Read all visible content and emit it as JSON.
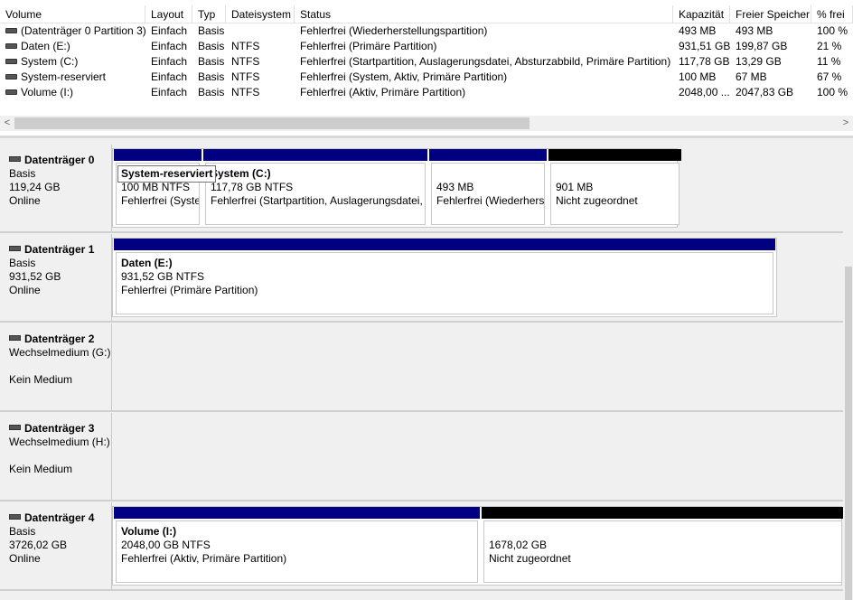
{
  "columns": [
    "Volume",
    "Layout",
    "Typ",
    "Dateisystem",
    "Status",
    "Kapazität",
    "Freier Speicher",
    "% frei"
  ],
  "volumes": [
    {
      "name": "(Datenträger 0 Partition 3)",
      "layout": "Einfach",
      "type": "Basis",
      "fs": "",
      "status": "Fehlerfrei (Wiederherstellungspartition)",
      "capacity": "493 MB",
      "free": "493 MB",
      "pct": "100 %"
    },
    {
      "name": "Daten (E:)",
      "layout": "Einfach",
      "type": "Basis",
      "fs": "NTFS",
      "status": "Fehlerfrei (Primäre Partition)",
      "capacity": "931,51 GB",
      "free": "199,87 GB",
      "pct": "21 %"
    },
    {
      "name": "System (C:)",
      "layout": "Einfach",
      "type": "Basis",
      "fs": "NTFS",
      "status": "Fehlerfrei (Startpartition, Auslagerungsdatei, Absturzabbild, Primäre Partition)",
      "capacity": "117,78 GB",
      "free": "13,29 GB",
      "pct": "11 %"
    },
    {
      "name": "System-reserviert",
      "layout": "Einfach",
      "type": "Basis",
      "fs": "NTFS",
      "status": "Fehlerfrei (System, Aktiv, Primäre Partition)",
      "capacity": "100 MB",
      "free": "67 MB",
      "pct": "67 %"
    },
    {
      "name": "Volume (I:)",
      "layout": "Einfach",
      "type": "Basis",
      "fs": "NTFS",
      "status": "Fehlerfrei (Aktiv, Primäre Partition)",
      "capacity": "2048,00 ...",
      "free": "2047,83 GB",
      "pct": "100 %"
    }
  ],
  "scroll": {
    "left_arrow": "<",
    "right_arrow": ">"
  },
  "disks": [
    {
      "title": "Datenträger 0",
      "line1": "Basis",
      "line2": "119,24 GB",
      "line3": "Online",
      "partitions": [
        {
          "name": "",
          "size": "100 MB NTFS",
          "status": "Fehlerfrei (System, Aktiv, Primäre Partition)",
          "bar": "blue"
        },
        {
          "name": "System  (C:)",
          "size": "117,78 GB NTFS",
          "status": "Fehlerfrei (Startpartition, Auslagerungsdatei, Absturzabbild, Primäre Partition)",
          "bar": "blue"
        },
        {
          "name": "",
          "size": "493 MB",
          "status": "Fehlerfrei (Wiederherstellungspartition)",
          "bar": "blue"
        },
        {
          "name": "",
          "size": "901 MB",
          "status": "Nicht zugeordnet",
          "bar": "black"
        }
      ]
    },
    {
      "title": "Datenträger 1",
      "line1": "Basis",
      "line2": "931,52 GB",
      "line3": "Online",
      "partitions": [
        {
          "name": "Daten  (E:)",
          "size": "931,52 GB NTFS",
          "status": "Fehlerfrei (Primäre Partition)",
          "bar": "blue"
        }
      ]
    },
    {
      "title": "Datenträger 2",
      "line1": "Wechselmedium (G:)",
      "line2": "",
      "line3": "Kein Medium",
      "partitions": []
    },
    {
      "title": "Datenträger 3",
      "line1": "Wechselmedium (H:)",
      "line2": "",
      "line3": "Kein Medium",
      "partitions": []
    },
    {
      "title": "Datenträger 4",
      "line1": "Basis",
      "line2": "3726,02 GB",
      "line3": "Online",
      "partitions": [
        {
          "name": "Volume  (I:)",
          "size": "2048,00 GB NTFS",
          "status": "Fehlerfrei (Aktiv, Primäre Partition)",
          "bar": "blue"
        },
        {
          "name": "",
          "size": "1678,02 GB",
          "status": "Nicht zugeordnet",
          "bar": "black"
        }
      ]
    }
  ],
  "tooltip": "System-reserviert",
  "colors": {
    "primary_bar": "#000080",
    "unallocated_bar": "#000000",
    "pane_bg": "#f0f0f0"
  }
}
